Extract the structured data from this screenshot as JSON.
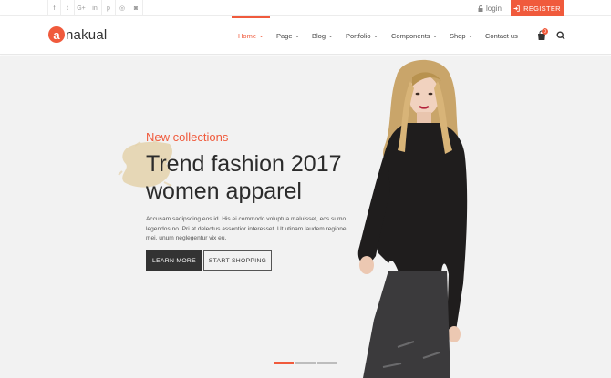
{
  "social": [
    {
      "icon": "facebook-icon",
      "glyph": "f"
    },
    {
      "icon": "twitter-icon",
      "glyph": "t"
    },
    {
      "icon": "google-plus-icon",
      "glyph": "G+"
    },
    {
      "icon": "linkedin-icon",
      "glyph": "in"
    },
    {
      "icon": "pinterest-icon",
      "glyph": "p"
    },
    {
      "icon": "dribbble-icon",
      "glyph": "◎"
    },
    {
      "icon": "instagram-icon",
      "glyph": "◙"
    }
  ],
  "topbar": {
    "login_label": "login",
    "register_label": "REGISTER"
  },
  "brand": {
    "logo_letter": "a",
    "logo_text": "nakual",
    "accent": "#f05a3c"
  },
  "menu": [
    {
      "label": "Home",
      "has_dropdown": true,
      "active": true
    },
    {
      "label": "Page",
      "has_dropdown": true
    },
    {
      "label": "Blog",
      "has_dropdown": true
    },
    {
      "label": "Portfolio",
      "has_dropdown": true
    },
    {
      "label": "Components",
      "has_dropdown": true
    },
    {
      "label": "Shop",
      "has_dropdown": true
    },
    {
      "label": "Contact us",
      "has_dropdown": false
    }
  ],
  "cart": {
    "count": "0"
  },
  "hero": {
    "eyebrow": "New collections",
    "headline_line1": "Trend fashion 2017",
    "headline_line2": "women apparel",
    "description": "Accusam sadipscing eos id. His ei commodo voluptua maluisset, eos sumo legendos no. Pri at delectus assentior interesset. Ut utinam laudem regione mei, unum neglegentur vix eu.",
    "primary_button": "LEARN MORE",
    "secondary_button": "START SHOPPING"
  },
  "slider": {
    "total": 3,
    "active": 1
  }
}
